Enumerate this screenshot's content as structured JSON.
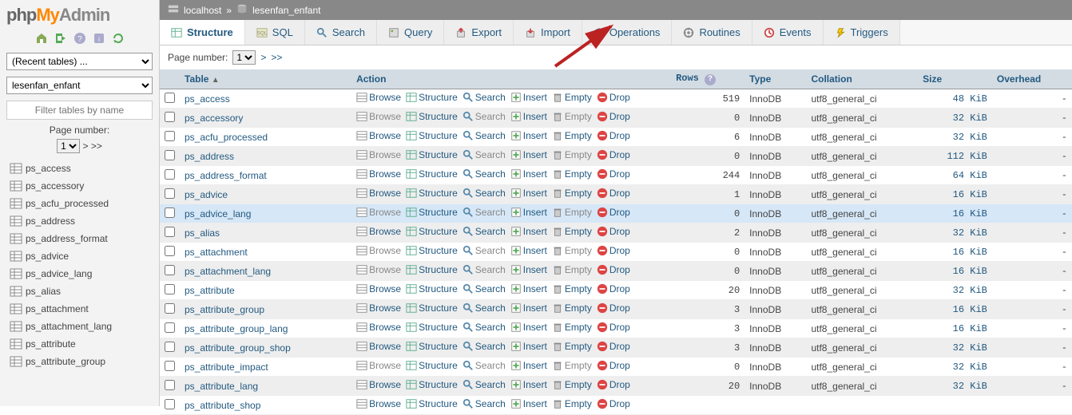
{
  "logo": {
    "php": "php",
    "my": "My",
    "admin": "Admin"
  },
  "sidebar": {
    "recent_tables": "(Recent tables) ...",
    "current_db": "lesenfan_enfant",
    "filter_placeholder": "Filter tables by name",
    "page_number_label": "Page number:",
    "page_number_value": "1",
    "nav_next": ">",
    "nav_last": ">>",
    "tables": [
      "ps_access",
      "ps_accessory",
      "ps_acfu_processed",
      "ps_address",
      "ps_address_format",
      "ps_advice",
      "ps_advice_lang",
      "ps_alias",
      "ps_attachment",
      "ps_attachment_lang",
      "ps_attribute",
      "ps_attribute_group"
    ]
  },
  "breadcrumb": {
    "host": "localhost",
    "sep": "»",
    "db": "lesenfan_enfant"
  },
  "tabs": [
    {
      "label": "Structure",
      "icon": "structure"
    },
    {
      "label": "SQL",
      "icon": "sql"
    },
    {
      "label": "Search",
      "icon": "search"
    },
    {
      "label": "Query",
      "icon": "query"
    },
    {
      "label": "Export",
      "icon": "export"
    },
    {
      "label": "Import",
      "icon": "import"
    },
    {
      "label": "Operations",
      "icon": "operations"
    },
    {
      "label": "Routines",
      "icon": "routines"
    },
    {
      "label": "Events",
      "icon": "events"
    },
    {
      "label": "Triggers",
      "icon": "triggers"
    }
  ],
  "page_control": {
    "label": "Page number:",
    "value": "1",
    "next": ">",
    "last": ">>"
  },
  "columns": {
    "table": "Table",
    "action": "Action",
    "rows": "Rows",
    "type": "Type",
    "collation": "Collation",
    "size": "Size",
    "overhead": "Overhead"
  },
  "actions": {
    "browse": "Browse",
    "structure": "Structure",
    "search": "Search",
    "insert": "Insert",
    "empty": "Empty",
    "drop": "Drop"
  },
  "rows": [
    {
      "name": "ps_access",
      "rows": "519",
      "type": "InnoDB",
      "collation": "utf8_general_ci",
      "size": "48 KiB",
      "overhead": "-",
      "disabled": false
    },
    {
      "name": "ps_accessory",
      "rows": "0",
      "type": "InnoDB",
      "collation": "utf8_general_ci",
      "size": "32 KiB",
      "overhead": "-",
      "disabled": true
    },
    {
      "name": "ps_acfu_processed",
      "rows": "6",
      "type": "InnoDB",
      "collation": "utf8_general_ci",
      "size": "32 KiB",
      "overhead": "-",
      "disabled": false
    },
    {
      "name": "ps_address",
      "rows": "0",
      "type": "InnoDB",
      "collation": "utf8_general_ci",
      "size": "112 KiB",
      "overhead": "-",
      "disabled": true
    },
    {
      "name": "ps_address_format",
      "rows": "244",
      "type": "InnoDB",
      "collation": "utf8_general_ci",
      "size": "64 KiB",
      "overhead": "-",
      "disabled": false
    },
    {
      "name": "ps_advice",
      "rows": "1",
      "type": "InnoDB",
      "collation": "utf8_general_ci",
      "size": "16 KiB",
      "overhead": "-",
      "disabled": false
    },
    {
      "name": "ps_advice_lang",
      "rows": "0",
      "type": "InnoDB",
      "collation": "utf8_general_ci",
      "size": "16 KiB",
      "overhead": "-",
      "disabled": true,
      "hover": true
    },
    {
      "name": "ps_alias",
      "rows": "2",
      "type": "InnoDB",
      "collation": "utf8_general_ci",
      "size": "32 KiB",
      "overhead": "-",
      "disabled": false
    },
    {
      "name": "ps_attachment",
      "rows": "0",
      "type": "InnoDB",
      "collation": "utf8_general_ci",
      "size": "16 KiB",
      "overhead": "-",
      "disabled": true
    },
    {
      "name": "ps_attachment_lang",
      "rows": "0",
      "type": "InnoDB",
      "collation": "utf8_general_ci",
      "size": "16 KiB",
      "overhead": "-",
      "disabled": true
    },
    {
      "name": "ps_attribute",
      "rows": "20",
      "type": "InnoDB",
      "collation": "utf8_general_ci",
      "size": "32 KiB",
      "overhead": "-",
      "disabled": false
    },
    {
      "name": "ps_attribute_group",
      "rows": "3",
      "type": "InnoDB",
      "collation": "utf8_general_ci",
      "size": "16 KiB",
      "overhead": "-",
      "disabled": false
    },
    {
      "name": "ps_attribute_group_lang",
      "rows": "3",
      "type": "InnoDB",
      "collation": "utf8_general_ci",
      "size": "16 KiB",
      "overhead": "-",
      "disabled": false
    },
    {
      "name": "ps_attribute_group_shop",
      "rows": "3",
      "type": "InnoDB",
      "collation": "utf8_general_ci",
      "size": "32 KiB",
      "overhead": "-",
      "disabled": false
    },
    {
      "name": "ps_attribute_impact",
      "rows": "0",
      "type": "InnoDB",
      "collation": "utf8_general_ci",
      "size": "32 KiB",
      "overhead": "-",
      "disabled": true
    },
    {
      "name": "ps_attribute_lang",
      "rows": "20",
      "type": "InnoDB",
      "collation": "utf8_general_ci",
      "size": "32 KiB",
      "overhead": "-",
      "disabled": false
    },
    {
      "name": "ps_attribute_shop",
      "rows": "",
      "type": "",
      "collation": "",
      "size": "",
      "overhead": "",
      "disabled": false
    }
  ]
}
